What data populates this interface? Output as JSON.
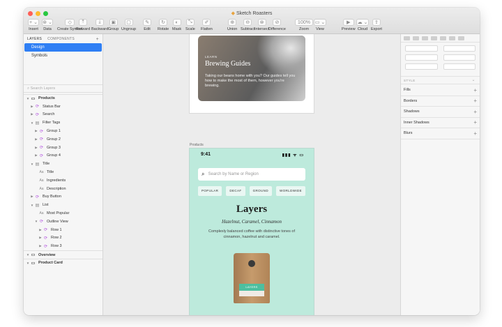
{
  "window": {
    "title": "Sketch Roasters",
    "traffic_colors": [
      "#ff5f57",
      "#febc2e",
      "#28c840"
    ]
  },
  "toolbar": {
    "items": [
      {
        "label": "Insert",
        "icon": "+ ⌄"
      },
      {
        "label": "Data",
        "icon": "⊛ ⌄"
      },
      {
        "label": "Create Symbol",
        "icon": "◇"
      },
      {
        "label": "Forward",
        "icon": "⤒"
      },
      {
        "label": "Backward",
        "icon": "⤓"
      },
      {
        "label": "Group",
        "icon": "▣"
      },
      {
        "label": "Ungroup",
        "icon": "▢"
      },
      {
        "label": "Edit",
        "icon": "✎"
      },
      {
        "label": "Rotate",
        "icon": "↻"
      },
      {
        "label": "Mask",
        "icon": "◐"
      },
      {
        "label": "Scale",
        "icon": "⤡"
      },
      {
        "label": "Flatten",
        "icon": "✐"
      },
      {
        "label": "Union",
        "icon": "⊕"
      },
      {
        "label": "Subtract",
        "icon": "⊖"
      },
      {
        "label": "Intersect",
        "icon": "⊗"
      },
      {
        "label": "Difference",
        "icon": "⊘"
      },
      {
        "label": "Zoom",
        "icon": "100%"
      },
      {
        "label": "View",
        "icon": "▭ ⌄"
      },
      {
        "label": "Preview",
        "icon": "▶"
      },
      {
        "label": "Cloud",
        "icon": "☁ ⌄"
      },
      {
        "label": "Export",
        "icon": "⇪"
      }
    ]
  },
  "left_panel": {
    "tabs": {
      "layers": "LAYERS",
      "components": "COMPONENTS",
      "add": "+"
    },
    "pages": [
      {
        "label": "Design",
        "selected": true
      },
      {
        "label": "Symbols",
        "selected": false
      }
    ],
    "filter_placeholder": "Search Layers",
    "layers": [
      {
        "label": "Products",
        "kind": "art",
        "level": 0,
        "icon": "▭",
        "arrow": "▼"
      },
      {
        "label": "Status Bar",
        "kind": "sym",
        "level": 1,
        "icon": "⟳",
        "arrow": "▶"
      },
      {
        "label": "Search",
        "kind": "sym",
        "level": 1,
        "icon": "⟳",
        "arrow": "▶"
      },
      {
        "label": "Filter Tags",
        "kind": "grp",
        "level": 1,
        "icon": "▤",
        "arrow": "▼"
      },
      {
        "label": "Group 1",
        "kind": "sym",
        "level": 2,
        "icon": "⟳",
        "arrow": "▶"
      },
      {
        "label": "Group 2",
        "kind": "sym",
        "level": 2,
        "icon": "⟳",
        "arrow": "▶"
      },
      {
        "label": "Group 3",
        "kind": "sym",
        "level": 2,
        "icon": "⟳",
        "arrow": "▶"
      },
      {
        "label": "Group 4",
        "kind": "sym",
        "level": 2,
        "icon": "⟳",
        "arrow": "▶"
      },
      {
        "label": "Title",
        "kind": "grp",
        "level": 1,
        "icon": "▤",
        "arrow": "▼"
      },
      {
        "label": "Title",
        "kind": "txt",
        "level": 2,
        "icon": "Aa",
        "arrow": ""
      },
      {
        "label": "Ingredients",
        "kind": "txt",
        "level": 2,
        "icon": "Aa",
        "arrow": ""
      },
      {
        "label": "Description",
        "kind": "txt",
        "level": 2,
        "icon": "Aa",
        "arrow": ""
      },
      {
        "label": "Buy Button",
        "kind": "sym",
        "level": 1,
        "icon": "⟳",
        "arrow": "▶"
      },
      {
        "label": "List",
        "kind": "grp",
        "level": 1,
        "icon": "▤",
        "arrow": "▼"
      },
      {
        "label": "Most Popular",
        "kind": "txt",
        "level": 2,
        "icon": "Aa",
        "arrow": ""
      },
      {
        "label": "Outline View",
        "kind": "sym",
        "level": 2,
        "icon": "⟳",
        "arrow": "▼"
      },
      {
        "label": "Row 1",
        "kind": "sym",
        "level": 3,
        "icon": "⟳",
        "arrow": "▶"
      },
      {
        "label": "Row 2",
        "kind": "sym",
        "level": 3,
        "icon": "⟳",
        "arrow": "▶"
      },
      {
        "label": "Row 3",
        "kind": "sym",
        "level": 3,
        "icon": "⟳",
        "arrow": "▶"
      },
      {
        "label": "Overview",
        "kind": "art",
        "level": 0,
        "icon": "▭",
        "arrow": "▼"
      },
      {
        "label": "Product Card",
        "kind": "art",
        "level": 0,
        "icon": "▭",
        "arrow": "▼"
      }
    ]
  },
  "canvas": {
    "guides_card": {
      "eyebrow": "LEARN",
      "title": "Brewing Guides",
      "body": "Taking our beans home with you? Our guides tell you how to make the most of them, however you're brewing."
    },
    "artboard_label": "Products",
    "phone": {
      "time": "9:41",
      "signal": "▮▮▮ ᯤ ▭",
      "search_placeholder": "Search by Name or Region",
      "chips": [
        "POPULAR",
        "DECAF",
        "GROUND",
        "WORLDWIDE"
      ],
      "product_title": "Layers",
      "product_notes": "Hazelnut, Caramel, Cinnamon",
      "product_desc": "Complexly balanced coffee with distinctive tones of cinnamon, hazelnut and caramel.",
      "bag_label": "LAYERS"
    }
  },
  "inspector": {
    "style_label": "STYLE",
    "sections": [
      "Fills",
      "Borders",
      "Shadows",
      "Inner Shadows",
      "Blurs"
    ]
  }
}
